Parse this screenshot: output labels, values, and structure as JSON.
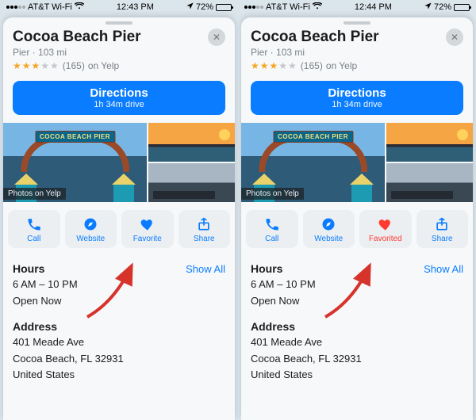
{
  "panes": [
    {
      "status": {
        "carrier": "AT&T Wi-Fi",
        "time": "12:43 PM",
        "battery_pct": "72%"
      },
      "place": {
        "name": "Cocoa Beach Pier",
        "category": "Pier",
        "distance": "103 mi",
        "rating_stars": 3,
        "rating_count": "(165)",
        "rating_source": "on Yelp",
        "sign_text": "COCOA BEACH PIER",
        "photos_label": "Photos on Yelp"
      },
      "directions": {
        "label": "Directions",
        "eta": "1h 34m drive"
      },
      "actions": {
        "call": "Call",
        "website": "Website",
        "favorite": {
          "label": "Favorite",
          "favorited": false
        },
        "share": "Share"
      },
      "hours": {
        "heading": "Hours",
        "range": "6 AM – 10 PM",
        "status": "Open Now",
        "show_all": "Show All"
      },
      "address": {
        "heading": "Address",
        "line1": "401 Meade Ave",
        "line2": "Cocoa Beach, FL  32931",
        "line3": "United States"
      }
    },
    {
      "status": {
        "carrier": "AT&T Wi-Fi",
        "time": "12:44 PM",
        "battery_pct": "72%"
      },
      "place": {
        "name": "Cocoa Beach Pier",
        "category": "Pier",
        "distance": "103 mi",
        "rating_stars": 3,
        "rating_count": "(165)",
        "rating_source": "on Yelp",
        "sign_text": "COCOA BEACH PIER",
        "photos_label": "Photos on Yelp"
      },
      "directions": {
        "label": "Directions",
        "eta": "1h 34m drive"
      },
      "actions": {
        "call": "Call",
        "website": "Website",
        "favorite": {
          "label": "Favorited",
          "favorited": true
        },
        "share": "Share"
      },
      "hours": {
        "heading": "Hours",
        "range": "6 AM – 10 PM",
        "status": "Open Now",
        "show_all": "Show All"
      },
      "address": {
        "heading": "Address",
        "line1": "401 Meade Ave",
        "line2": "Cocoa Beach, FL  32931",
        "line3": "United States"
      }
    }
  ],
  "colors": {
    "accent": "#0a7cff",
    "favorite_on": "#ff3b30"
  }
}
